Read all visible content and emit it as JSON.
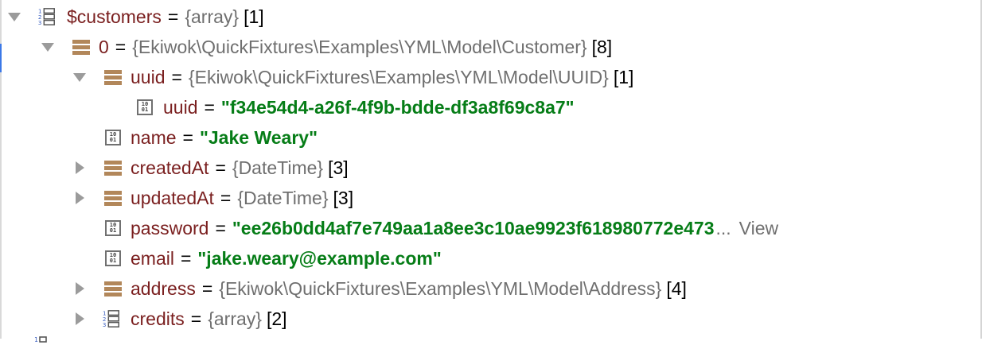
{
  "tree": {
    "rows": [
      {
        "key": "$customers",
        "type": "{array}",
        "count": "[1]"
      },
      {
        "key": "0",
        "type": "{Ekiwok\\QuickFixtures\\Examples\\YML\\Model\\Customer}",
        "count": "[8]"
      },
      {
        "key": "uuid",
        "type": "{Ekiwok\\QuickFixtures\\Examples\\YML\\Model\\UUID}",
        "count": "[1]"
      },
      {
        "key": "uuid",
        "value": "\"f34e54d4-a26f-4f9b-bdde-df3a8f69c8a7\""
      },
      {
        "key": "name",
        "value": "\"Jake Weary\""
      },
      {
        "key": "createdAt",
        "type": "{DateTime}",
        "count": "[3]"
      },
      {
        "key": "updatedAt",
        "type": "{DateTime}",
        "count": "[3]"
      },
      {
        "key": "password",
        "value": "\"ee26b0dd4af7e749aa1a8ee3c10ae9923f618980772e473",
        "ellipsis": "...",
        "view_link": "View"
      },
      {
        "key": "email",
        "value": "\"jake.weary@example.com\""
      },
      {
        "key": "address",
        "type": "{Ekiwok\\QuickFixtures\\Examples\\YML\\Model\\Address}",
        "count": "[4]"
      },
      {
        "key": "credits",
        "type": "{array}",
        "count": "[2]"
      }
    ],
    "equals": "="
  },
  "icons": {
    "array": "array-icon",
    "object": "object-icon",
    "primitive": "primitive-icon",
    "expanded": "triangle-down-icon",
    "collapsed": "triangle-right-icon"
  },
  "colors": {
    "key": "#7a1f1f",
    "string": "#067d17",
    "type": "#6f6f6f",
    "object_icon": "#b2875a"
  }
}
